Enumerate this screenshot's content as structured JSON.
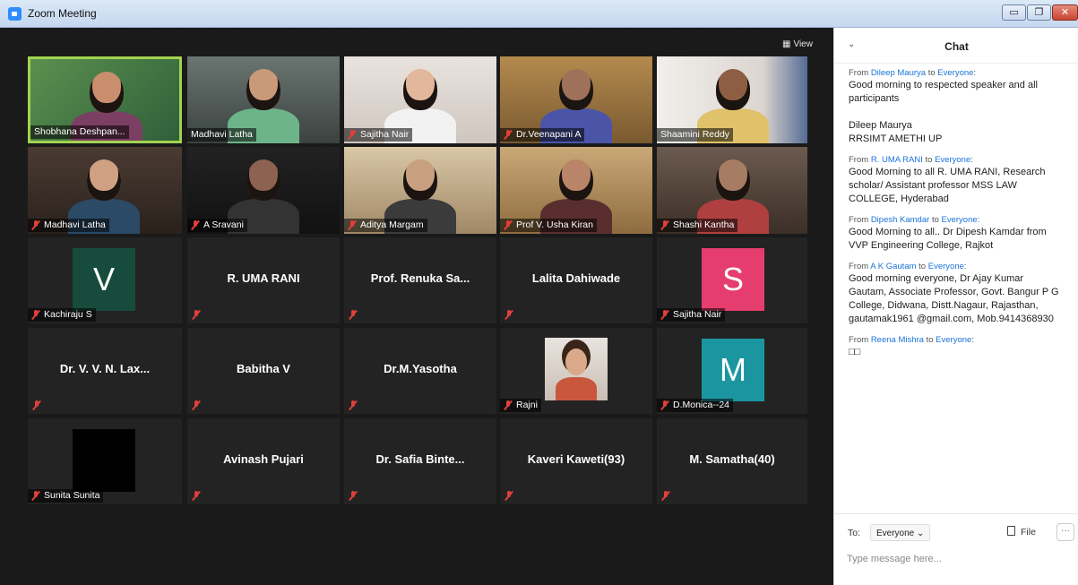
{
  "window": {
    "title": "Zoom Meeting",
    "min_glyph": "▭",
    "max_glyph": "❐",
    "close_glyph": "✕"
  },
  "video": {
    "view_label": "View",
    "view_icon": "grid-icon",
    "tiles": [
      {
        "name": "Shobhana Deshpan...",
        "type": "video",
        "muted": false,
        "active": true
      },
      {
        "name": "Madhavi Latha",
        "type": "video",
        "muted": false
      },
      {
        "name": "Sajitha Nair",
        "type": "video",
        "muted": true
      },
      {
        "name": "Dr.Veenapani A",
        "type": "video",
        "muted": true
      },
      {
        "name": "Shaamini Reddy",
        "type": "video",
        "muted": false
      },
      {
        "name": "Madhavi Latha",
        "type": "video",
        "muted": true
      },
      {
        "name": "A Sravani",
        "type": "video",
        "muted": true
      },
      {
        "name": "Aditya Margam",
        "type": "video",
        "muted": true
      },
      {
        "name": "Prof V. Usha Kiran",
        "type": "video",
        "muted": true
      },
      {
        "name": "Shashi Kantha",
        "type": "video",
        "muted": true
      },
      {
        "name": "Kachiraju S",
        "type": "avatar",
        "letter": "V",
        "color": "#174c3c",
        "muted": true
      },
      {
        "name": "R. UMA RANI",
        "type": "name",
        "muted": true
      },
      {
        "name": "Prof. Renuka Sa...",
        "type": "name",
        "muted": true
      },
      {
        "name": "Lalita Dahiwade",
        "type": "name",
        "muted": true
      },
      {
        "name": "Sajitha Nair",
        "type": "avatar",
        "letter": "S",
        "color": "#e53d6d",
        "muted": true
      },
      {
        "name": "Dr. V. V. N. Lax...",
        "type": "name",
        "muted": true
      },
      {
        "name": "Babitha V",
        "type": "name",
        "muted": true
      },
      {
        "name": "Dr.M.Yasotha",
        "type": "name",
        "muted": true
      },
      {
        "name": "Rajni",
        "type": "photo",
        "muted": true
      },
      {
        "name": "D.Monica--24",
        "type": "avatar",
        "letter": "M",
        "color": "#1b96a0",
        "muted": true
      },
      {
        "name": "Sunita Sunita",
        "type": "black",
        "muted": true
      },
      {
        "name": "Avinash Pujari",
        "type": "name",
        "muted": true
      },
      {
        "name": "Dr. Safia Binte...",
        "type": "name",
        "muted": true
      },
      {
        "name": "Kaveri Kaweti(93)",
        "type": "name",
        "muted": true
      },
      {
        "name": "M. Samatha(40)",
        "type": "name",
        "muted": true
      }
    ]
  },
  "chat": {
    "title": "Chat",
    "collapse_glyph": "⌄",
    "messages": [
      {
        "from_prefix": "From",
        "sender": "Dileep Maurya",
        "to_word": "to",
        "recipient": "Everyone",
        "suffix": ":",
        "text": "Good morning to respected speaker and all participants\n\nDileep Maurya\nRRSIMT AMETHI UP"
      },
      {
        "from_prefix": "From",
        "sender": "R. UMA RANI",
        "to_word": "to",
        "recipient": "Everyone",
        "suffix": ":",
        "text": "Good Morning to all R. UMA RANI, Research scholar/ Assistant professor MSS LAW COLLEGE, Hyderabad"
      },
      {
        "from_prefix": "From",
        "sender": "Dipesh Kamdar",
        "to_word": "to",
        "recipient": "Everyone",
        "suffix": ":",
        "text": "Good Morning to all.. Dr Dipesh Kamdar from VVP Engineering College, Rajkot"
      },
      {
        "from_prefix": "From",
        "sender": "A K Gautam",
        "to_word": "to",
        "recipient": "Everyone",
        "suffix": ":",
        "text": "Good morning everyone, Dr Ajay Kumar Gautam, Associate Professor, Govt. Bangur P G College, Didwana, Distt.Nagaur, Rajasthan, gautamak1961 @gmail.com, Mob.9414368930"
      },
      {
        "from_prefix": "From",
        "sender": "Reena Mishra",
        "to_word": "to",
        "recipient": "Everyone",
        "suffix": ":",
        "text": "□□"
      }
    ],
    "footer": {
      "to_label": "To:",
      "to_value": "Everyone ⌄",
      "file_label": "File",
      "more_label": "···",
      "input_placeholder": "Type message here..."
    }
  }
}
